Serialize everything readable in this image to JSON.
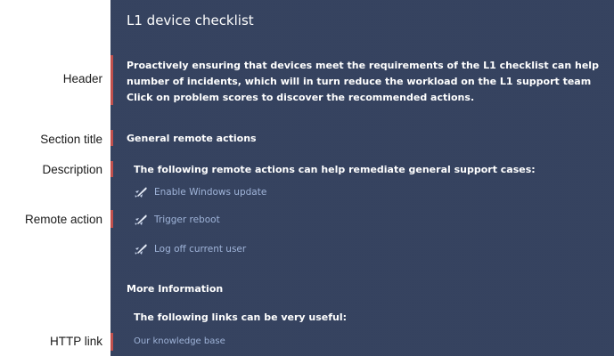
{
  "annotations": {
    "header": "Header",
    "section_title": "Section title",
    "description": "Description",
    "remote_action": "Remote action",
    "http_link": "HTTP link"
  },
  "panel": {
    "title": "L1 device checklist",
    "header_lines": [
      "Proactively ensuring that devices meet the requirements of the L1 checklist can help",
      "number of incidents, which will in turn reduce the workload on the L1 support team",
      "Click on problem scores to discover the recommended actions."
    ],
    "section1": {
      "title": "General remote actions",
      "description": "The following remote actions can help remediate general support cases:",
      "actions": [
        {
          "label": "Enable Windows update",
          "icon": "rocket-icon"
        },
        {
          "label": "Trigger reboot",
          "icon": "rocket-icon"
        },
        {
          "label": "Log off current user",
          "icon": "rocket-icon"
        }
      ]
    },
    "section2": {
      "title": "More Information",
      "description": "The following links can be very useful:",
      "link": "Our knowledge base"
    }
  },
  "colors": {
    "panel_bg": "#2f3d5a",
    "accent_bar": "#c0504d",
    "link": "#9fb3d8",
    "text": "#ffffff"
  }
}
